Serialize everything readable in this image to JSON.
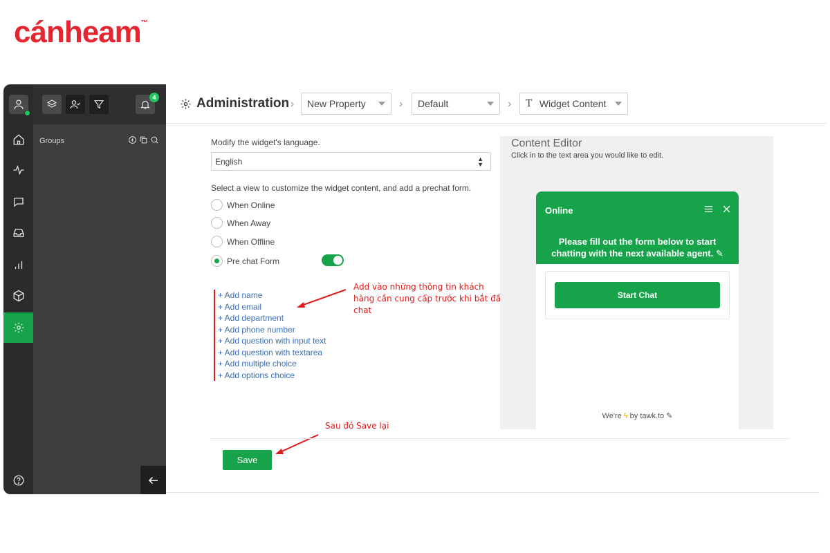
{
  "brand": {
    "logo_text": "cánheam",
    "trademark": "™"
  },
  "rail": {
    "icons": [
      "user-icon",
      "home-icon",
      "activity-icon",
      "chat-icon",
      "inbox-icon",
      "reports-icon",
      "box-icon",
      "settings-icon",
      "help-icon"
    ]
  },
  "groups_panel": {
    "label": "Groups",
    "notification_count": "4"
  },
  "header": {
    "title": "Administration",
    "breadcrumbs": [
      "New Property",
      "Default",
      "Widget Content"
    ]
  },
  "form": {
    "language_label": "Modify the widget's language.",
    "language_value": "English",
    "view_label": "Select a view to customize the widget content, and add a prechat form.",
    "views": [
      {
        "label": "When Online",
        "checked": false
      },
      {
        "label": "When Away",
        "checked": false
      },
      {
        "label": "When Offline",
        "checked": false
      },
      {
        "label": "Pre chat Form",
        "checked": true
      }
    ],
    "prechat_enabled": true,
    "add_items": [
      "+ Add name",
      "+ Add email",
      "+ Add department",
      "+ Add phone number",
      "+ Add question with input text",
      "+ Add question with textarea",
      "+ Add multiple choice",
      "+ Add options choice"
    ],
    "save_label": "Save"
  },
  "annotations": {
    "add_note": [
      "Add vào những thông tin khách",
      "hàng cần cung cấp trước khi bắt đầu",
      "chat"
    ],
    "save_note": "Sau đó Save lại",
    "color": "#e01b1b"
  },
  "editor": {
    "title": "Content Editor",
    "subtitle": "Click in to the text area you would like to edit.",
    "widget_status": "Online",
    "widget_message": "Please fill out the form below to start chatting with the next available agent.",
    "start_chat_label": "Start Chat",
    "footer_pre": "We're",
    "footer_post": "by tawk.to"
  },
  "colors": {
    "accent": "#16a34a",
    "brand": "#e3262f",
    "link": "#3d6fb6"
  }
}
